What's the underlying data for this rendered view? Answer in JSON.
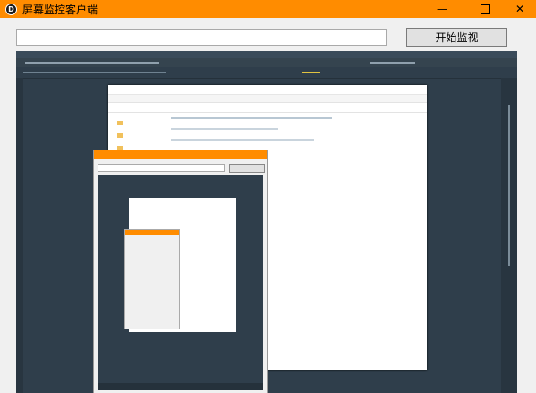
{
  "window": {
    "title": "屏幕监控客户端",
    "logo_letter": "D",
    "minimize_glyph": "—",
    "close_glyph": "✕"
  },
  "toolbar": {
    "address_value": "",
    "start_button_label": "开始监视"
  },
  "colors": {
    "titlebar": "#ff8c00",
    "remote_background": "#2f3e4b"
  }
}
